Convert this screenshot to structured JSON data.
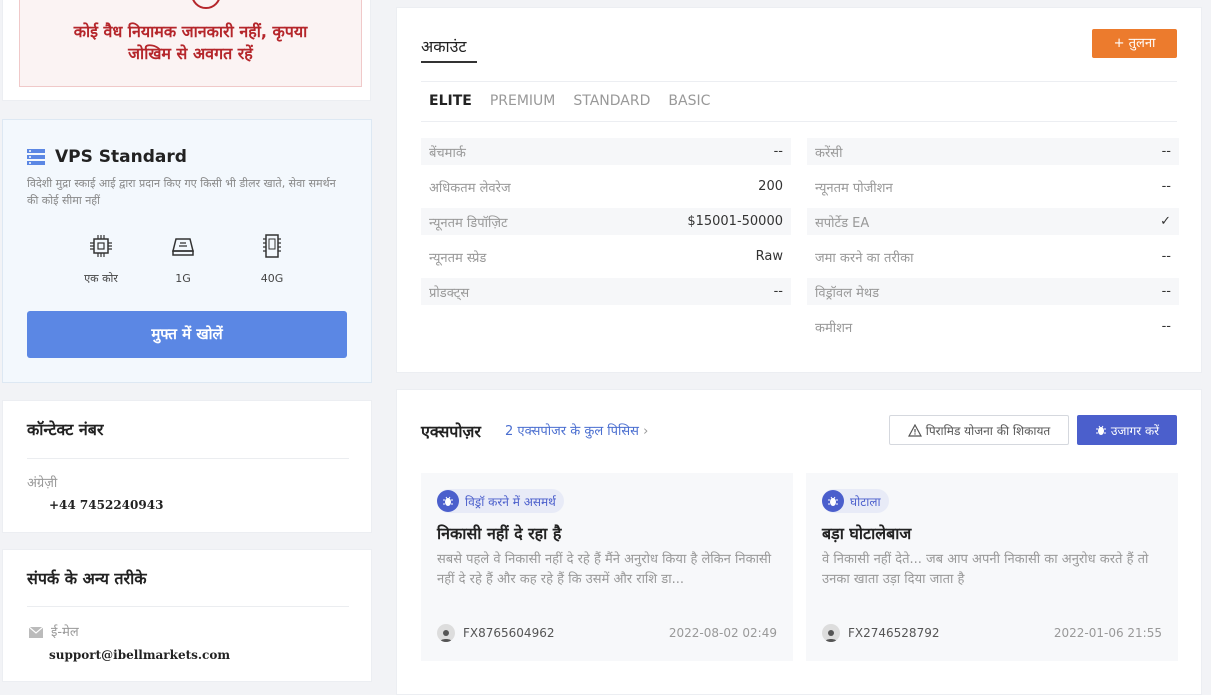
{
  "warning": {
    "icon": "!",
    "text": "कोई वैध नियामक जानकारी नहीं, कृपया जोखिम से अवगत रहें"
  },
  "vps": {
    "title": "VPS Standard",
    "description": "विदेशी मुद्रा स्काई आई द्वारा प्रदान किए गए किसी भी डीलर खाते, सेवा समर्थन की कोई सीमा नहीं",
    "specs": {
      "core": "एक कोर",
      "ram": "1G",
      "disk": "40G"
    },
    "button": "मुफ्त में खोलें"
  },
  "contact": {
    "title": "कॉन्टेक्ट नंबर",
    "label": "अंग्रेज़ी",
    "phone": "+44 7452240943"
  },
  "other_contact": {
    "title": "संपर्क के अन्य तरीके",
    "label": "ई-मेल",
    "email": "support@ibellmarkets.com"
  },
  "account": {
    "title": "अकाउंट",
    "compare_button": "+ तुलना",
    "tabs": [
      "ELITE",
      "PREMIUM",
      "STANDARD",
      "BASIC"
    ],
    "left": [
      {
        "key": "बेंचमार्क",
        "value": "--"
      },
      {
        "key": "अधिकतम लेवरेज",
        "value": "200"
      },
      {
        "key": "न्यूनतम डिपॉज़िट",
        "value": "$15001-50000"
      },
      {
        "key": "न्यूनतम स्प्रेड",
        "value": "Raw"
      },
      {
        "key": "प्रोडक्ट्स",
        "value": "--"
      }
    ],
    "right": [
      {
        "key": "करेंसी",
        "value": "--"
      },
      {
        "key": "न्यूनतम पोजीशन",
        "value": "--"
      },
      {
        "key": "सपोर्टेड EA",
        "value": "✓"
      },
      {
        "key": "जमा करने का तरीका",
        "value": "--"
      },
      {
        "key": "विड्रॉवल मेथड",
        "value": "--"
      },
      {
        "key": "कमीशन",
        "value": "--"
      }
    ]
  },
  "exposure": {
    "title": "एक्सपोज़र",
    "count_link": "2 एक्सपोजर के कुल पिसिस",
    "complain_button": "पिरामिड योजना की शिकायत",
    "expose_button": "उजागर करें",
    "items": [
      {
        "tag": "विड्रॉ करने में असमर्थ",
        "title": "निकासी नहीं दे रहा है",
        "body": "सबसे पहले वे निकासी नहीं दे रहे हैं मैंने अनुरोध किया है लेकिन निकासी नहीं दे रहे हैं और कह रहे हैं कि उसमें और राशि डा...",
        "user": "FX8765604962",
        "date": "2022-08-02 02:49"
      },
      {
        "tag": "घोटाला",
        "title": "बड़ा घोटालेबाज",
        "body": "वे निकासी नहीं देते... जब आप अपनी निकासी का अनुरोध करते हैं तो उनका खाता उड़ा दिया जाता है",
        "user": "FX2746528792",
        "date": "2022-01-06 21:55"
      }
    ]
  }
}
